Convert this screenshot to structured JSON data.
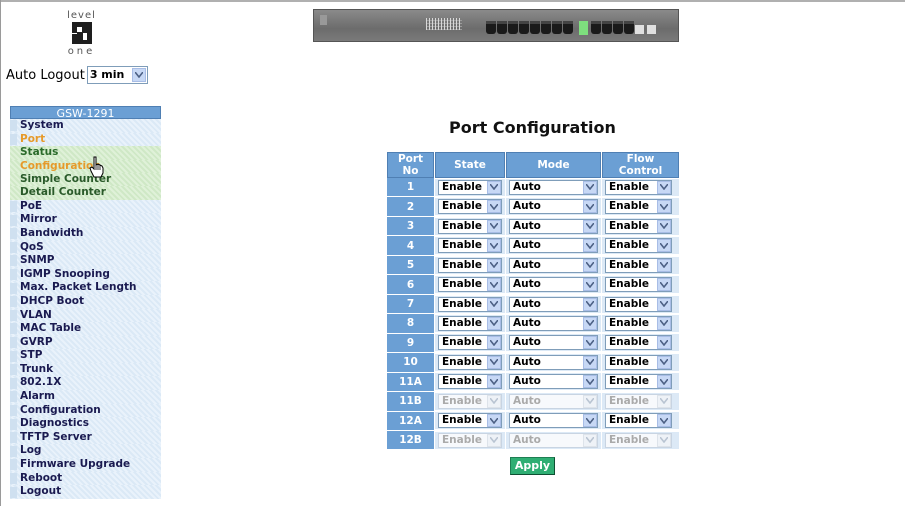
{
  "logo": {
    "top": "level",
    "bottom": "one"
  },
  "auto_logout": {
    "label": "Auto Logout",
    "value": "3 min"
  },
  "nav": {
    "title": "GSW-1291",
    "items_before": [
      "System"
    ],
    "port": "Port",
    "port_sub": [
      "Status",
      "Configuration",
      "Simple Counter",
      "Detail Counter"
    ],
    "items_after": [
      "PoE",
      "Mirror",
      "Bandwidth",
      "QoS",
      "SNMP",
      "IGMP Snooping",
      "Max. Packet Length",
      "DHCP Boot",
      "VLAN",
      "MAC Table",
      "GVRP",
      "STP",
      "Trunk",
      "802.1X",
      "Alarm",
      "Configuration",
      "Diagnostics",
      "TFTP Server",
      "Log",
      "Firmware Upgrade",
      "Reboot",
      "Logout"
    ]
  },
  "page_title": "Port Configuration",
  "table": {
    "headers": [
      "Port No",
      "State",
      "Mode",
      "Flow Control"
    ],
    "rows": [
      {
        "port": "1",
        "state": "Enable",
        "mode": "Auto",
        "flow": "Enable",
        "disabled": false
      },
      {
        "port": "2",
        "state": "Enable",
        "mode": "Auto",
        "flow": "Enable",
        "disabled": false
      },
      {
        "port": "3",
        "state": "Enable",
        "mode": "Auto",
        "flow": "Enable",
        "disabled": false
      },
      {
        "port": "4",
        "state": "Enable",
        "mode": "Auto",
        "flow": "Enable",
        "disabled": false
      },
      {
        "port": "5",
        "state": "Enable",
        "mode": "Auto",
        "flow": "Enable",
        "disabled": false
      },
      {
        "port": "6",
        "state": "Enable",
        "mode": "Auto",
        "flow": "Enable",
        "disabled": false
      },
      {
        "port": "7",
        "state": "Enable",
        "mode": "Auto",
        "flow": "Enable",
        "disabled": false
      },
      {
        "port": "8",
        "state": "Enable",
        "mode": "Auto",
        "flow": "Enable",
        "disabled": false
      },
      {
        "port": "9",
        "state": "Enable",
        "mode": "Auto",
        "flow": "Enable",
        "disabled": false
      },
      {
        "port": "10",
        "state": "Enable",
        "mode": "Auto",
        "flow": "Enable",
        "disabled": false
      },
      {
        "port": "11A",
        "state": "Enable",
        "mode": "Auto",
        "flow": "Enable",
        "disabled": false
      },
      {
        "port": "11B",
        "state": "Enable",
        "mode": "Auto",
        "flow": "Enable",
        "disabled": true
      },
      {
        "port": "12A",
        "state": "Enable",
        "mode": "Auto",
        "flow": "Enable",
        "disabled": false
      },
      {
        "port": "12B",
        "state": "Enable",
        "mode": "Auto",
        "flow": "Enable",
        "disabled": true
      }
    ]
  },
  "apply_label": "Apply",
  "colors": {
    "nav_header": "#6b9fd4",
    "active_nav": "#e69a2a",
    "apply": "#2fae73"
  }
}
